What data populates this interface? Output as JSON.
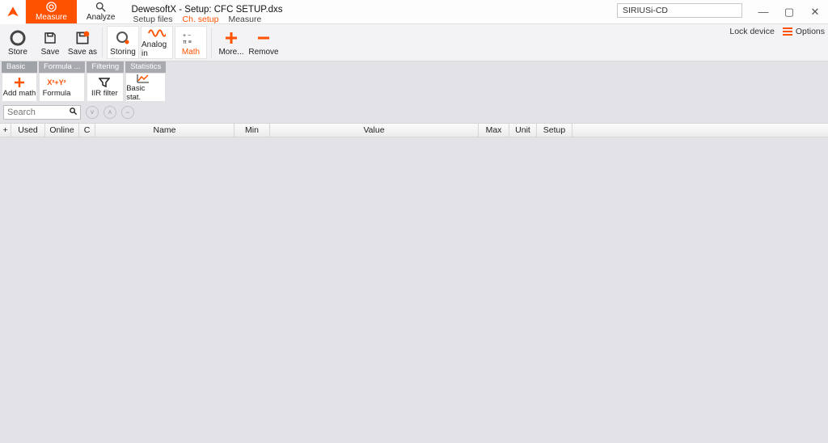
{
  "app": {
    "title": "DewesoftX - Setup: CFC SETUP.dxs",
    "device_name": "SIRIUSi-CD",
    "lock_device": "Lock device",
    "options": "Options"
  },
  "modes": {
    "measure": "Measure",
    "analyze": "Analyze"
  },
  "subtabs": {
    "setup_files": "Setup files",
    "ch_setup": "Ch. setup",
    "measure": "Measure"
  },
  "toolbar": {
    "store": "Store",
    "save": "Save",
    "save_as": "Save as",
    "storing": "Storing",
    "analog_in": "Analog in",
    "math": "Math",
    "more": "More...",
    "remove": "Remove"
  },
  "mathgroups": {
    "basic": "Basic",
    "formula_grp": "Formula ...",
    "filtering": "Filtering",
    "statistics": "Statistics",
    "add_math": "Add math",
    "formula": "Formula",
    "iir_filter": "IIR filter",
    "basic_stat": "Basic stat."
  },
  "search": {
    "placeholder": "Search"
  },
  "columns": {
    "plus": "+",
    "used": "Used",
    "online": "Online",
    "c": "C",
    "name": "Name",
    "min": "Min",
    "value": "Value",
    "max": "Max",
    "unit": "Unit",
    "setup": "Setup"
  },
  "colors": {
    "accent": "#ff5200"
  }
}
